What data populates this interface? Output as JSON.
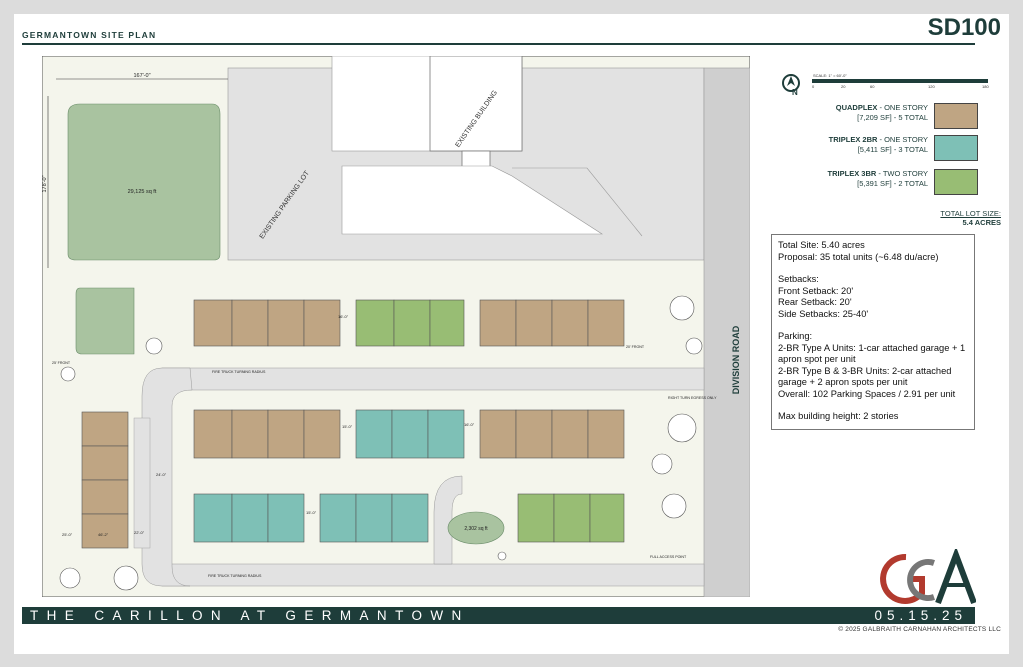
{
  "header": {
    "plan_title": "GERMANTOWN SITE PLAN",
    "sheet_id": "SD100"
  },
  "colors": {
    "quadplex": "#bfa583",
    "triplex_2br": "#7ec0b6",
    "triplex_3br": "#98bd74",
    "green_space": "#a9c3a0",
    "parking": "#e2e2e2",
    "road": "#cfcfcf",
    "site": "#f4f5ec",
    "brand_dark": "#1e3d3a",
    "logo_red": "#b23a2e",
    "logo_gray": "#777777"
  },
  "plan": {
    "dim_top": "167'-0\"",
    "dim_left": "178'-0\"",
    "lawn_area": "29,125 sq ft",
    "pond_area": "2,302 sq ft",
    "existing_building": "EXISTING BUILDING",
    "existing_parking": "EXISTING PARKING LOT",
    "division_road": "DIVISION ROAD",
    "fire_radius_top": "FIRE TRUCK TURNING RADIUS",
    "fire_radius_bottom": "FIRE TRUCK TURNING RADIUS",
    "right_turn": "RIGHT TURN EGRESS ONLY",
    "full_access": "FULL ACCESS POINT",
    "setback_left": "25' FRONT",
    "setback_right": "20' FRONT",
    "dims": {
      "d_16": "16'-0\"",
      "d_15a": "15'-0\"",
      "d_16b": "16'-0\"",
      "d_15b": "15'-0\"",
      "d_24": "24'-0\"",
      "d_22": "22'-0\"",
      "d_25": "25'-0\"",
      "d_46": "46'-2\""
    }
  },
  "scale": {
    "label": "SCALE: 1\" = 60'-0\"",
    "ticks": [
      "0",
      "20",
      "60",
      "120",
      "180"
    ]
  },
  "legend": [
    {
      "type": "QUADPLEX",
      "stories": " - ONE STORY",
      "detail": "[7,209 SF] - 5 TOTAL",
      "color_key": "quadplex"
    },
    {
      "type": "TRIPLEX 2BR",
      "stories": " - ONE STORY",
      "detail": "[5,411 SF] - 3 TOTAL",
      "color_key": "triplex_2br"
    },
    {
      "type": "TRIPLEX 3BR",
      "stories": " - TWO STORY",
      "detail": "[5,391 SF] - 2 TOTAL",
      "color_key": "triplex_3br"
    }
  ],
  "total_lot": {
    "label": "TOTAL LOT SIZE:",
    "value": "5.4 ACRES"
  },
  "summary": {
    "total_site": "Total Site: 5.40 acres",
    "proposal": "Proposal: 35 total units (~6.48 du/acre)",
    "setbacks_heading": "Setbacks:",
    "front": "Front Setback: 20'",
    "rear": "Rear Setback: 20'",
    "side": "Side Setbacks: 25-40'",
    "parking_heading": "Parking:",
    "parking_a": "2-BR Type A Units: 1-car attached garage + 1 apron spot per unit",
    "parking_b": "2-BR Type B & 3-BR Units: 2-car attached garage + 2 apron spots per unit",
    "overall": "Overall: 102 Parking Spaces / 2.91 per unit",
    "max_height": "Max building height: 2 stories"
  },
  "footer": {
    "project_title": "THE CARILLON AT GERMANTOWN",
    "date": "05.15.25",
    "copyright": "© 2025 GALBRAITH CARNAHAN ARCHITECTS LLC"
  },
  "logo": {
    "letters": "GCA",
    "compass_letter": "N"
  }
}
